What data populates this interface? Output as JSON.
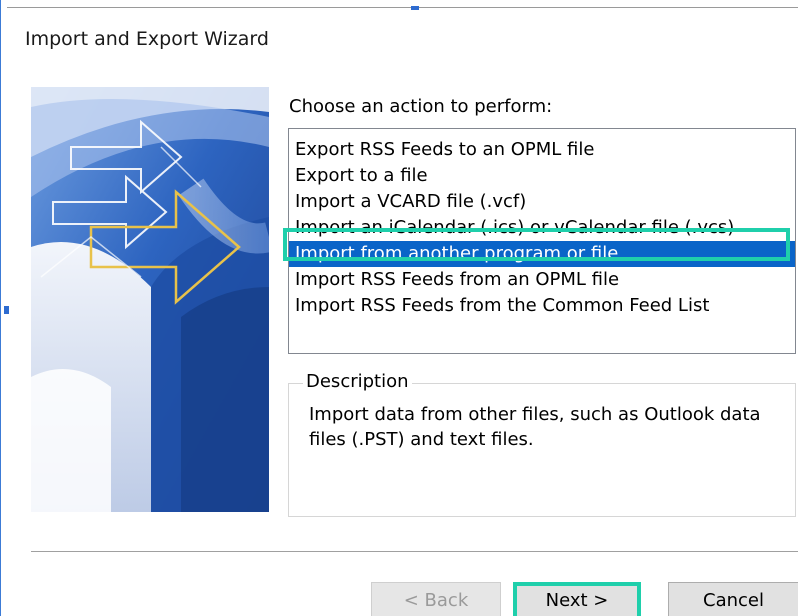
{
  "window": {
    "title": "Import and Export Wizard"
  },
  "wizard": {
    "prompt": "Choose an action to perform:",
    "actions": [
      {
        "label": "Export RSS Feeds to an OPML file",
        "selected": false
      },
      {
        "label": "Export to a file",
        "selected": false
      },
      {
        "label": "Import a VCARD file (.vcf)",
        "selected": false
      },
      {
        "label": "Import an iCalendar (.ics) or vCalendar file (.vcs)",
        "selected": false
      },
      {
        "label": "Import from another program or file",
        "selected": true
      },
      {
        "label": "Import RSS Feeds from an OPML file",
        "selected": false
      },
      {
        "label": "Import RSS Feeds from the Common Feed List",
        "selected": false
      }
    ],
    "description_label": "Description",
    "description_text": "Import data from other files, such as Outlook data files (.PST) and text files."
  },
  "buttons": {
    "back_label": "< Back",
    "next_label": "Next >",
    "cancel_label": "Cancel"
  },
  "colors": {
    "selection": "#0a64c8",
    "highlight_outline": "#1fcfab",
    "banner_blue": "#2a62bd"
  },
  "icons": {
    "banner": "wizard-arrows-illustration"
  }
}
